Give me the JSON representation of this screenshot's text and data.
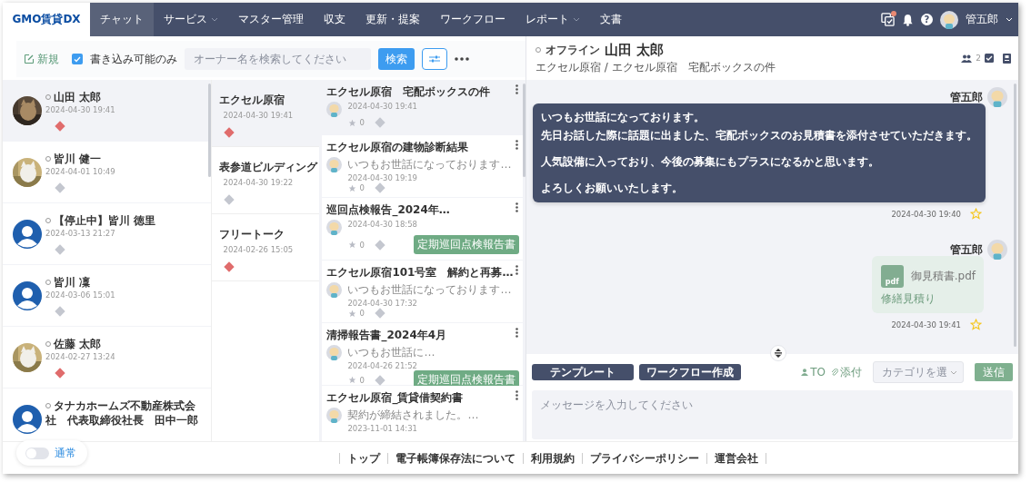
{
  "nav": {
    "logo": "GMO賃貸DX",
    "menu": [
      {
        "label": "チャット",
        "selected": true,
        "dropdown": false
      },
      {
        "label": "サービス",
        "selected": false,
        "dropdown": true
      },
      {
        "label": "マスター管理",
        "selected": false,
        "dropdown": false
      },
      {
        "label": "収支",
        "selected": false,
        "dropdown": false
      },
      {
        "label": "更新・提案",
        "selected": false,
        "dropdown": false
      },
      {
        "label": "ワークフロー",
        "selected": false,
        "dropdown": false
      },
      {
        "label": "レポート",
        "selected": false,
        "dropdown": true
      },
      {
        "label": "文書",
        "selected": false,
        "dropdown": false
      }
    ],
    "tasks_alert": true,
    "help": "?",
    "user": "管五郎"
  },
  "toolbar": {
    "new": "新規",
    "writable_only": {
      "label": "書き込み可能のみ",
      "checked": true
    },
    "search": {
      "placeholder": "オーナー名を検索してください"
    },
    "search_button": "検索"
  },
  "owners": [
    {
      "name": [
        "山田 太郎"
      ],
      "time": "2024-04-30 19:41",
      "color": "#e06c6c",
      "selected": true
    },
    {
      "name": [
        "皆川 健一"
      ],
      "time": "2024-04-01 10:49",
      "color": "#c4c7cf",
      "selected": false
    },
    {
      "name": [
        "【停止中】皆川 徳里"
      ],
      "time": "2024-03-13 21:27",
      "kind": "default",
      "color": "#c4c7cf",
      "selected": false
    },
    {
      "name": [
        "皆川 凜"
      ],
      "time": "2024-03-06 15:01",
      "kind": "default",
      "color": "#c4c7cf",
      "selected": false
    },
    {
      "name": [
        "佐藤 太郎"
      ],
      "time": "2024-02-27 13:24",
      "color": "#e06c6c",
      "selected": false
    },
    {
      "name": [
        "タナカホームズ不動産株式会",
        "社　代表取締役社長　田中一郎"
      ],
      "kind": "default",
      "selected": false
    }
  ],
  "properties": [
    {
      "name": "エクセル原宿",
      "time": "2024-04-30 19:41",
      "color": "#e06c6c",
      "selected": true
    },
    {
      "name": "表参道ビルディング",
      "time": "2024-04-30 19:22",
      "color": "#c4c7cf",
      "selected": false
    },
    {
      "name": "フリートーク",
      "time": "2024-02-26 15:05",
      "color": "#e06c6c",
      "selected": false
    }
  ],
  "threads": [
    {
      "title": "エクセル原宿　宅配ボックスの件",
      "time": "2024-04-30 19:41",
      "star_count": "0",
      "selected": true
    },
    {
      "title": "エクセル原宿の建物診断結果",
      "preview": "いつもお世話になっております…",
      "time": "2024-04-30 19:19",
      "star_count": "0",
      "selected": false
    },
    {
      "title": "巡回点検報告_2024年…",
      "time": "2024-04-30 18:58",
      "star_count": "0",
      "label": "定期巡回点検報告書",
      "selected": false
    },
    {
      "title": "エクセル原宿101号室　解約と再募…",
      "preview": "いつもお世話になっております…",
      "time": "2024-04-30 17:32",
      "star_count": "0",
      "selected": false
    },
    {
      "title": "清掃報告書_2024年4月",
      "preview": "いつもお世話に…",
      "time": "2024-04-26 21:52",
      "star_count": "0",
      "label": "定期巡回点検報告書",
      "selected": false
    },
    {
      "title": "エクセル原宿_賃貸借契約書",
      "preview": "契約が締結されました。…",
      "time": "2023-11-01 14:31",
      "selected": false
    }
  ],
  "chat": {
    "status": "オフライン",
    "name": "山田 太郎",
    "path": "エクセル原宿 / エクセル原宿　宅配ボックスの件",
    "members": "2",
    "messages": [
      {
        "kind": "text",
        "sender": "管五郎",
        "paragraphs": [
          [
            "いつもお世話になっております。",
            "先日お話した際に話題に出ました、宅配ボックスのお見積書を添付させていただきます。"
          ],
          [
            "人気設備に入っており、今後の募集にもプラスになるかと思います。"
          ],
          [
            "よろしくお願いいたします。"
          ]
        ],
        "time": "2024-04-30 19:40",
        "starred": false
      },
      {
        "kind": "file",
        "sender": "管五郎",
        "file_type": "pdf",
        "file_name": "御見積書.pdf",
        "note": "修繕見積り",
        "time": "2024-04-30 19:41",
        "starred": false
      }
    ]
  },
  "composer": {
    "buttons": [
      "テンプレート",
      "ワークフロー作成"
    ],
    "to": "TO",
    "attach": "添付",
    "category": {
      "placeholder": "カテゴリを選"
    },
    "send": "送信",
    "message": {
      "placeholder": "メッセージを入力してください"
    }
  },
  "footer": {
    "mode": {
      "label": "通常",
      "on": false
    },
    "links": [
      "トップ",
      "電子帳簿保存法について",
      "利用規約",
      "プライバシーポリシー",
      "運営会社"
    ]
  }
}
